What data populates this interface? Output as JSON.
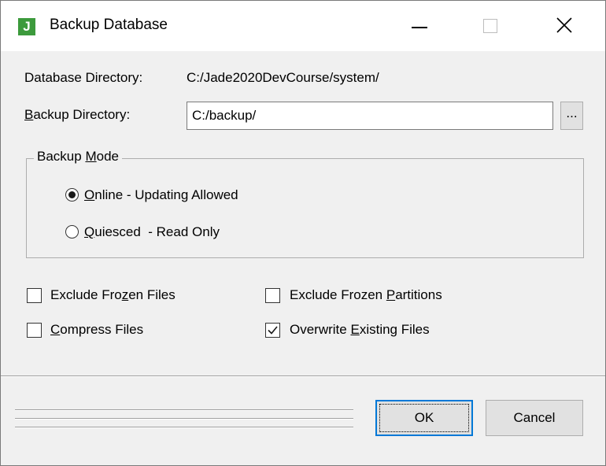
{
  "window": {
    "title": "Backup Database",
    "icon_letter": "J",
    "controls": [
      "minimize-icon",
      "maximize-icon",
      "close-icon"
    ]
  },
  "database_directory": {
    "label": "Database Directory:",
    "value": "C:/Jade2020DevCourse/system/"
  },
  "backup_directory": {
    "label_accel": "B",
    "label_rest": "ackup Directory:",
    "value": "C:/backup/",
    "browse_label": "..."
  },
  "backup_mode": {
    "legend_pre": "Backup ",
    "legend_accel": "M",
    "legend_post": "ode",
    "options": [
      {
        "accel": "O",
        "rest": "nline - Updating Allowed",
        "checked": true
      },
      {
        "accel": "Q",
        "rest": "uiesced  - Read Only",
        "checked": false
      }
    ]
  },
  "options": {
    "exclude_frozen_files": {
      "pre": "Exclude Fro",
      "accel": "z",
      "post": "en Files",
      "checked": false
    },
    "exclude_frozen_partitions": {
      "pre": "Exclude Frozen ",
      "accel": "P",
      "post": "artitions",
      "checked": false
    },
    "compress_files": {
      "pre": "",
      "accel": "C",
      "post": "ompress Files",
      "checked": false
    },
    "overwrite_existing_files": {
      "pre": "Overwrite ",
      "accel": "E",
      "post": "xisting Files",
      "checked": true
    }
  },
  "buttons": {
    "ok": "OK",
    "cancel": "Cancel"
  }
}
